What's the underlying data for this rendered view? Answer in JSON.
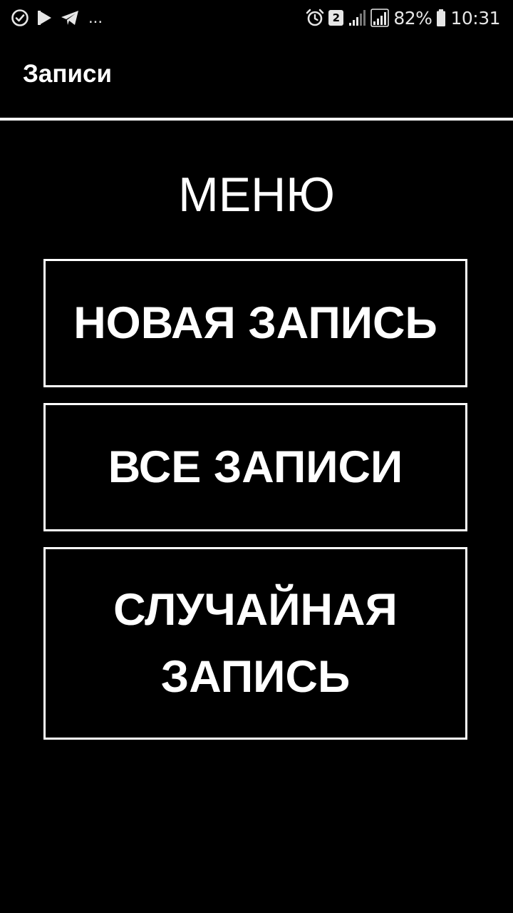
{
  "status_bar": {
    "left_icons": [
      "alarm-check-icon",
      "play-icon",
      "telegram-icon"
    ],
    "more_indicator": "...",
    "sim_badge": "2",
    "battery_percent": "82%",
    "time": "10:31"
  },
  "app_bar": {
    "title": "Записи"
  },
  "menu": {
    "heading": "МЕНЮ",
    "buttons": [
      {
        "label": "НОВАЯ ЗАПИСЬ"
      },
      {
        "label": "ВСЕ ЗАПИСИ"
      },
      {
        "label": "СЛУЧАЙНАЯ ЗАПИСЬ"
      }
    ]
  },
  "colors": {
    "background": "#000000",
    "foreground": "#ffffff",
    "status_icons": "#e6e6e6"
  }
}
